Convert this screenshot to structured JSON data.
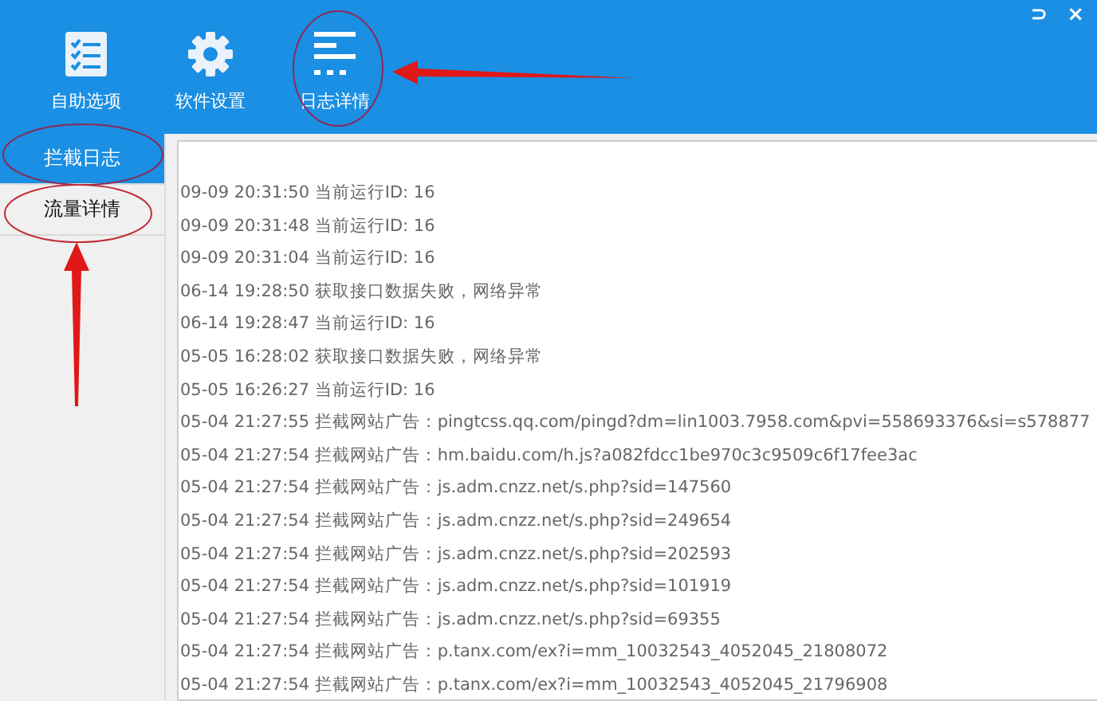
{
  "toolbar": [
    {
      "label": "自助选项"
    },
    {
      "label": "软件设置"
    },
    {
      "label": "日志详情"
    }
  ],
  "window_controls": [
    "⊃",
    "×"
  ],
  "sidebar": {
    "items": [
      {
        "label": "拦截日志",
        "selected": true
      },
      {
        "label": "流量详情",
        "selected": false
      }
    ]
  },
  "log": {
    "lines": [
      {
        "time": "09-09 20:31:50",
        "message": "当前运行ID: 16"
      },
      {
        "time": "09-09 20:31:48",
        "message": "当前运行ID: 16"
      },
      {
        "time": "09-09 20:31:04",
        "message": "当前运行ID: 16"
      },
      {
        "time": "06-14 19:28:50",
        "message": "获取接口数据失败，网络异常"
      },
      {
        "time": "06-14 19:28:47",
        "message": "当前运行ID: 16"
      },
      {
        "time": "05-05 16:28:02",
        "message": "获取接口数据失败，网络异常"
      },
      {
        "time": "05-05 16:26:27",
        "message": "当前运行ID: 16"
      },
      {
        "time": "05-04 21:27:55",
        "message": "拦截网站广告：pingtcss.qq.com/pingd?dm=lin1003.7958.com&pvi=558693376&si=s578877"
      },
      {
        "time": "05-04 21:27:54",
        "message": "拦截网站广告：hm.baidu.com/h.js?a082fdcc1be970c3c9509c6f17fee3ac"
      },
      {
        "time": "05-04 21:27:54",
        "message": "拦截网站广告：js.adm.cnzz.net/s.php?sid=147560"
      },
      {
        "time": "05-04 21:27:54",
        "message": "拦截网站广告：js.adm.cnzz.net/s.php?sid=249654"
      },
      {
        "time": "05-04 21:27:54",
        "message": "拦截网站广告：js.adm.cnzz.net/s.php?sid=202593"
      },
      {
        "time": "05-04 21:27:54",
        "message": "拦截网站广告：js.adm.cnzz.net/s.php?sid=101919"
      },
      {
        "time": "05-04 21:27:54",
        "message": "拦截网站广告：js.adm.cnzz.net/s.php?sid=69355"
      },
      {
        "time": "05-04 21:27:54",
        "message": "拦截网站广告：p.tanx.com/ex?i=mm_10032543_4052045_21808072"
      },
      {
        "time": "05-04 21:27:54",
        "message": "拦截网站广告：p.tanx.com/ex?i=mm_10032543_4052045_21796908"
      }
    ]
  }
}
